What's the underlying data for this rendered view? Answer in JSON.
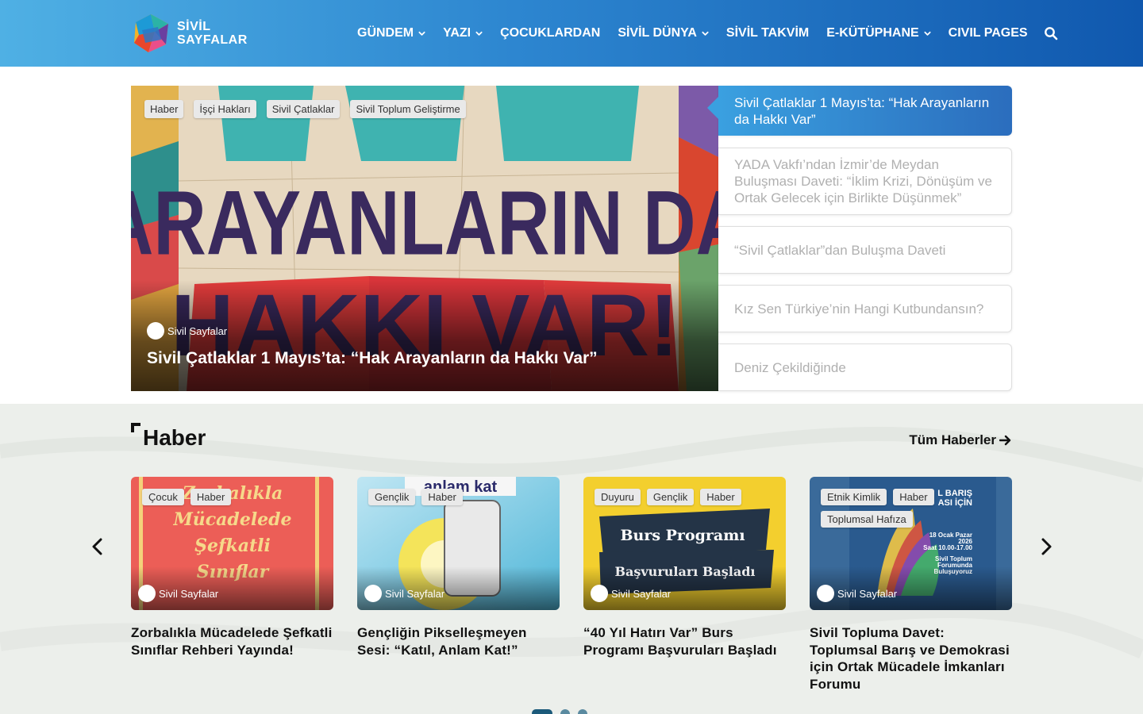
{
  "header": {
    "logo": {
      "line1": "SİVİL",
      "line2": "SAYFALAR"
    },
    "nav": [
      {
        "label": "GÜNDEM",
        "dropdown": true
      },
      {
        "label": "YAZI",
        "dropdown": true
      },
      {
        "label": "ÇOCUKLARDAN",
        "dropdown": false
      },
      {
        "label": "SİVİL DÜNYA",
        "dropdown": true
      },
      {
        "label": "SİVİL TAKVİM",
        "dropdown": false
      },
      {
        "label": "E-KÜTÜPHANE",
        "dropdown": true
      },
      {
        "label": "CIVIL PAGES",
        "dropdown": false
      }
    ],
    "search_icon": "search-icon"
  },
  "hero": {
    "tags": [
      "Haber",
      "İşçi Hakları",
      "Sivil Çatlaklar",
      "Sivil Toplum Geliştirme"
    ],
    "image_text": [
      "HAK",
      "ARAYANLARIN DA",
      "HAKKI VAR!"
    ],
    "author": "Sivil Sayfalar",
    "title": "Sivil Çatlaklar 1 Mayıs’ta: “Hak Arayanların da Hakkı Var”"
  },
  "side_list": [
    {
      "title": "Sivil Çatlaklar 1 Mayıs’ta: “Hak Arayanların da Hakkı Var”",
      "active": true
    },
    {
      "title": "YADA Vakfı’ndan İzmir’de Meydan Buluşması Daveti: “İklim Krizi, Dönüşüm ve Ortak Gelecek için Birlikte Düşünmek”",
      "active": false
    },
    {
      "title": "“Sivil Çatlaklar”dan Buluşma Daveti",
      "active": false
    },
    {
      "title": "Kız Sen Türkiye’nin Hangi Kutbundansın?",
      "active": false
    },
    {
      "title": "Deniz Çekildiğinde",
      "active": false
    }
  ],
  "section": {
    "title": "Haber",
    "all_link": "Tüm Haberler",
    "cards": [
      {
        "tags": [
          "Çocuk",
          "Haber"
        ],
        "image_text": [
          "Zorbalıkla",
          "Mücadelede",
          "Şefkatli",
          "Sınıflar"
        ],
        "author": "Sivil Sayfalar",
        "title": "Zorbalıkla Mücadelede Şefkatli Sınıflar Rehberi Yayında!"
      },
      {
        "tags": [
          "Gençlik",
          "Haber"
        ],
        "image_text": [
          "anlam kat"
        ],
        "author": "Sivil Sayfalar",
        "title": "Gençliğin Pikselleşmeyen Sesi: “Katıl, Anlam Kat!”"
      },
      {
        "tags": [
          "Duyuru",
          "Gençlik",
          "Haber"
        ],
        "image_text": [
          "Burs Programı",
          "Başvuruları Başladı"
        ],
        "author": "Sivil Sayfalar",
        "title": "“40 Yıl Hatırı Var” Burs Programı Başvuruları Başladı"
      },
      {
        "tags": [
          "Etnik Kimlik",
          "Haber",
          "Toplumsal Hafıza"
        ],
        "image_text": [
          "L BARIŞ",
          "ASI İÇİN",
          "18 Ocak Pazar",
          "2026",
          "Saat 10.00-17.00",
          "Sivil Toplum",
          "Forumunda",
          "Buluşuyoruz"
        ],
        "author": "Sivil Sayfalar",
        "title": "Sivil Topluma Davet: Toplumsal Barış ve Demokrasi için Ortak Mücadele İmkanları Forumu"
      }
    ],
    "pagination": {
      "pages": 3,
      "current": 1
    }
  }
}
